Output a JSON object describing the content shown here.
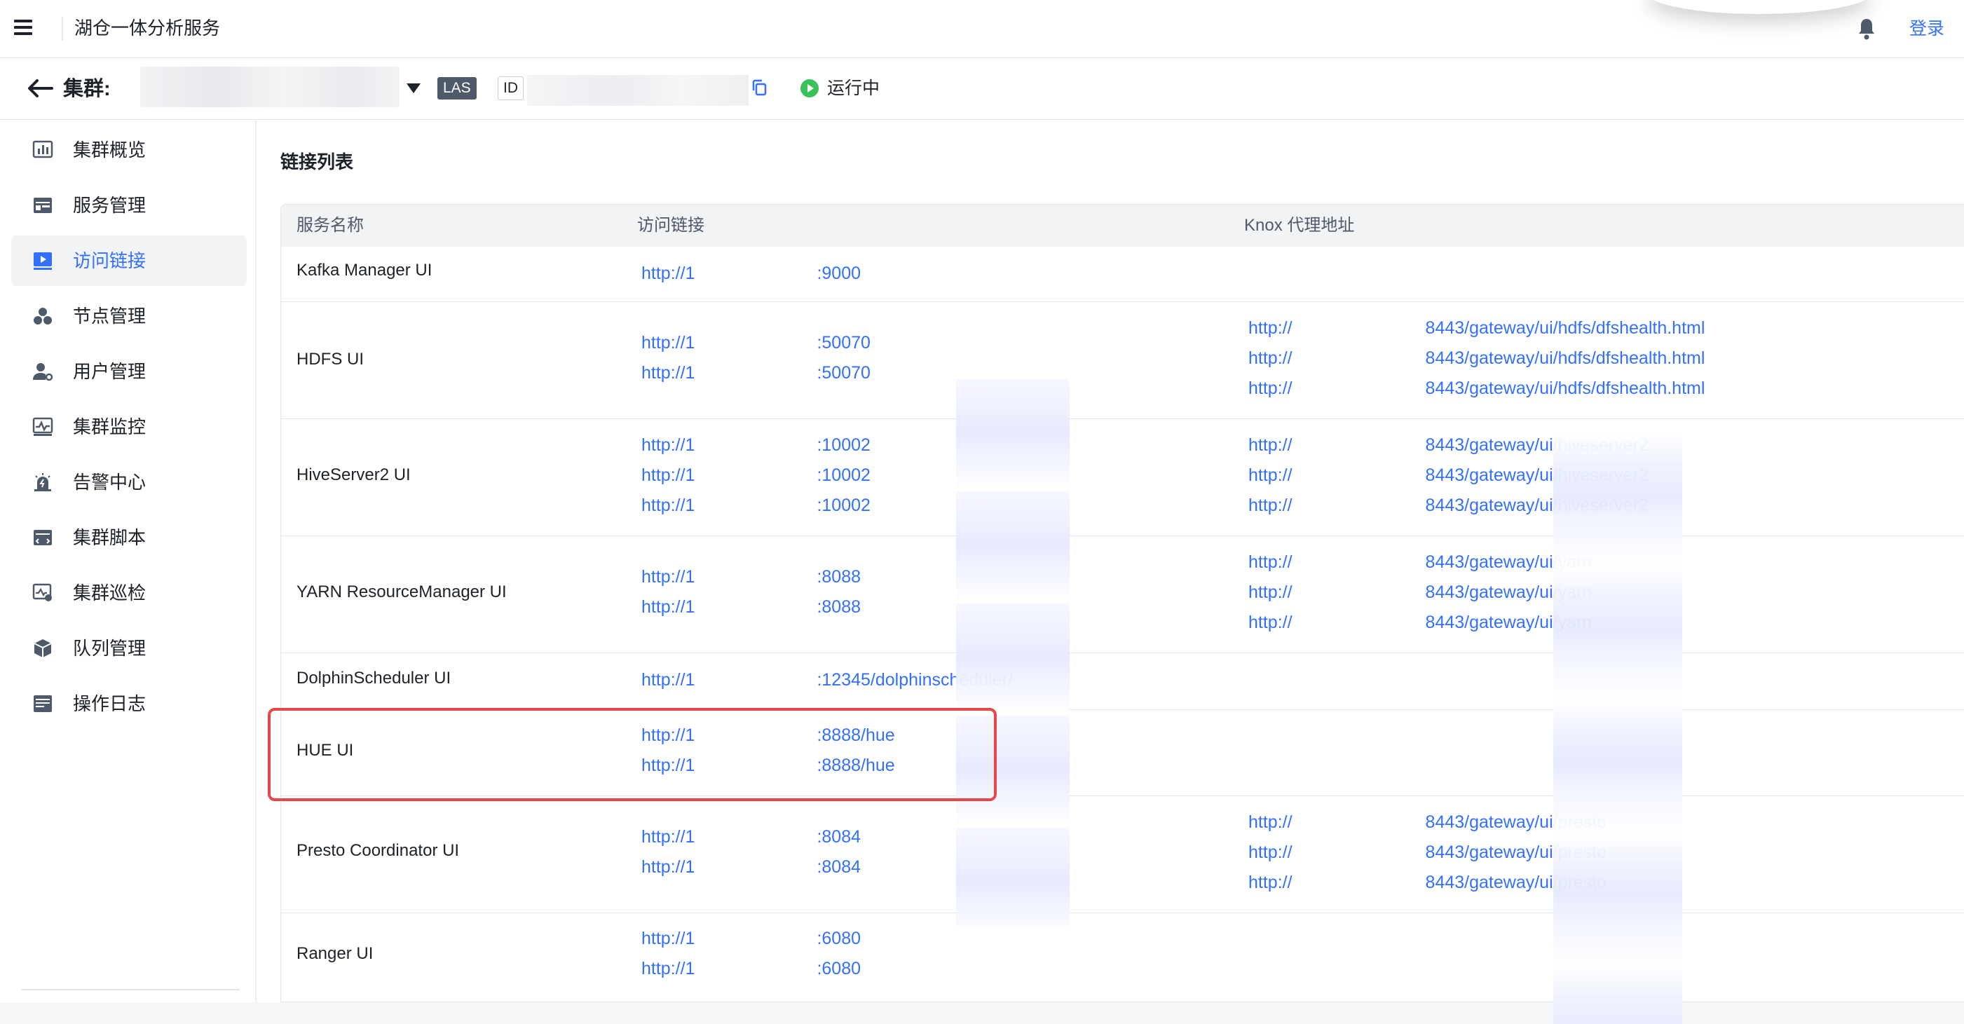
{
  "header": {
    "app_title": "湖仓一体分析服务",
    "login_label": "登录"
  },
  "cluster_bar": {
    "cluster_label": "集群:",
    "type_badge": "LAS",
    "id_label": "ID",
    "status_text": "运行中"
  },
  "sidebar": {
    "items": [
      {
        "label": "集群概览",
        "icon": "bar-chart-icon"
      },
      {
        "label": "服务管理",
        "icon": "service-icon"
      },
      {
        "label": "访问链接",
        "icon": "play-link-icon",
        "active": true
      },
      {
        "label": "节点管理",
        "icon": "nodes-icon"
      },
      {
        "label": "用户管理",
        "icon": "user-gear-icon"
      },
      {
        "label": "集群监控",
        "icon": "monitor-icon"
      },
      {
        "label": "告警中心",
        "icon": "alarm-icon"
      },
      {
        "label": "集群脚本",
        "icon": "script-icon"
      },
      {
        "label": "集群巡检",
        "icon": "inspect-icon"
      },
      {
        "label": "队列管理",
        "icon": "cube-icon"
      },
      {
        "label": "操作日志",
        "icon": "log-icon"
      }
    ]
  },
  "main": {
    "section_title": "链接列表",
    "columns": [
      "服务名称",
      "访问链接",
      "Knox 代理地址"
    ],
    "rows": [
      {
        "name": "Kafka Manager UI",
        "links": [
          [
            "http://1",
            ":9000"
          ]
        ],
        "knox": []
      },
      {
        "name": "HDFS UI",
        "links": [
          [
            "http://1",
            ":50070"
          ],
          [
            "http://1",
            ":50070"
          ]
        ],
        "knox": [
          [
            "http://",
            "8443/gateway/ui/hdfs/dfshealth.html"
          ],
          [
            "http://",
            "8443/gateway/ui/hdfs/dfshealth.html"
          ],
          [
            "http://",
            "8443/gateway/ui/hdfs/dfshealth.html"
          ]
        ]
      },
      {
        "name": "HiveServer2 UI",
        "links": [
          [
            "http://1",
            ":10002"
          ],
          [
            "http://1",
            ":10002"
          ],
          [
            "http://1",
            ":10002"
          ]
        ],
        "knox": [
          [
            "http://",
            "8443/gateway/ui/hiveserver2"
          ],
          [
            "http://",
            "8443/gateway/ui/hiveserver2"
          ],
          [
            "http://",
            "8443/gateway/ui/hiveserver2"
          ]
        ]
      },
      {
        "name": "YARN ResourceManager UI",
        "links": [
          [
            "http://1",
            ":8088"
          ],
          [
            "http://1",
            ":8088"
          ]
        ],
        "knox": [
          [
            "http://",
            "8443/gateway/ui/yarn"
          ],
          [
            "http://",
            "8443/gateway/ui/yarn"
          ],
          [
            "http://",
            "8443/gateway/ui/yarn"
          ]
        ]
      },
      {
        "name": "DolphinScheduler UI",
        "links": [
          [
            "http://1",
            ":12345/dolphinscheduler/"
          ]
        ],
        "knox": []
      },
      {
        "name": "HUE UI",
        "links": [
          [
            "http://1",
            ":8888/hue"
          ],
          [
            "http://1",
            ":8888/hue"
          ]
        ],
        "knox": []
      },
      {
        "name": "Presto Coordinator UI",
        "links": [
          [
            "http://1",
            ":8084"
          ],
          [
            "http://1",
            ":8084"
          ]
        ],
        "knox": [
          [
            "http://",
            "8443/gateway/ui/presto"
          ],
          [
            "http://",
            "8443/gateway/ui/presto"
          ],
          [
            "http://",
            "8443/gateway/ui/presto"
          ]
        ]
      },
      {
        "name": "Ranger UI",
        "links": [
          [
            "http://1",
            ":6080"
          ],
          [
            "http://1",
            ":6080"
          ]
        ],
        "knox": []
      }
    ]
  },
  "colors": {
    "accent": "#3370ff",
    "status_running": "#3ac25a",
    "highlight_border": "#e84749"
  }
}
